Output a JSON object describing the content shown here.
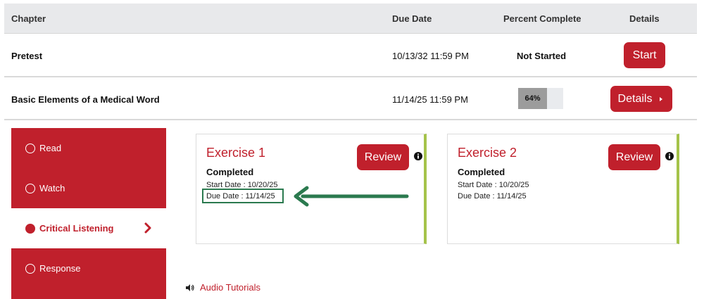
{
  "table": {
    "headers": {
      "chapter": "Chapter",
      "due_date": "Due Date",
      "percent_complete": "Percent Complete",
      "details": "Details"
    },
    "rows": [
      {
        "chapter": "Pretest",
        "due_date": "10/13/32 11:59 PM",
        "status": "Not Started",
        "action_label": "Start"
      },
      {
        "chapter": "Basic Elements of a Medical Word",
        "due_date": "11/14/25 11:59 PM",
        "progress_percent": 64,
        "progress_label": "64%",
        "action_label": "Details"
      }
    ]
  },
  "sidebar": {
    "items": [
      {
        "label": "Read"
      },
      {
        "label": "Watch"
      },
      {
        "label": "Critical Listening"
      },
      {
        "label": "Response"
      }
    ],
    "active_index": 2
  },
  "exercises": [
    {
      "title": "Exercise 1",
      "status": "Completed",
      "start_date": "Start Date : 10/20/25",
      "due_date": "Due Date : 11/14/25",
      "button_label": "Review"
    },
    {
      "title": "Exercise 2",
      "status": "Completed",
      "start_date": "Start Date : 10/20/25",
      "due_date": "Due Date : 11/14/25",
      "button_label": "Review"
    }
  ],
  "audio_tutorials": {
    "label": "Audio Tutorials"
  },
  "colors": {
    "brand_red": "#c0202c",
    "accent_green": "#a5c34a",
    "annotation_green": "#2b7a4f",
    "progress_gray": "#9c9c9c"
  },
  "icons": [
    "info-icon",
    "caret-right-icon",
    "chevron-right-icon",
    "speaker-icon",
    "arrow-left-icon"
  ]
}
